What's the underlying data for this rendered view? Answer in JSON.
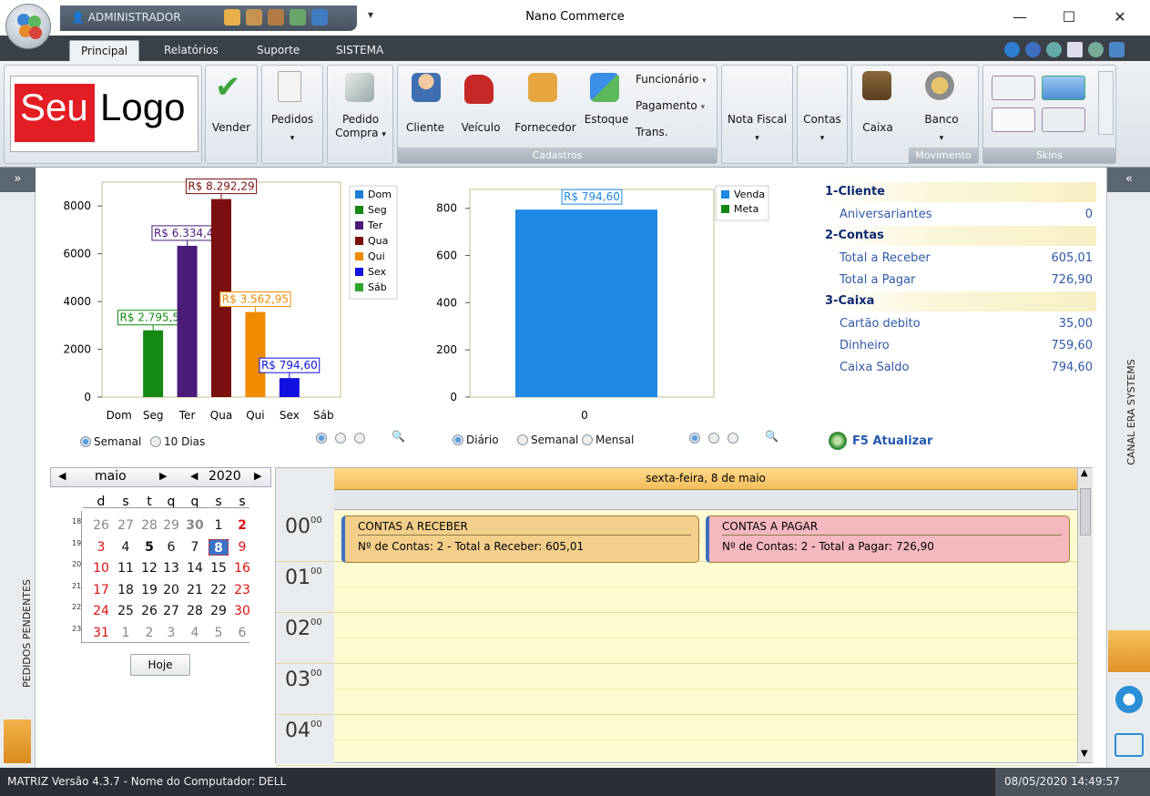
{
  "window": {
    "title": "Nano Commerce",
    "user": "ADMINISTRADOR",
    "controls": {
      "minimize": "—",
      "maximize": "☐",
      "close": "✕"
    },
    "qat_dropdown": "▾"
  },
  "tabs": [
    "Principal",
    "Relatórios",
    "Suporte",
    "SISTEMA"
  ],
  "logo": {
    "part1": "Seu",
    "part2": "Logo"
  },
  "ribbon": {
    "vender": "Vender",
    "pedidos": "Pedidos",
    "pedido_compra_1": "Pedido",
    "pedido_compra_2": "Compra",
    "cliente": "Cliente",
    "veiculo": "Veículo",
    "fornecedor": "Fornecedor",
    "estoque": "Estoque",
    "funcionario": "Funcionário",
    "pagamento": "Pagamento",
    "trans": "Trans.",
    "cadastros_caption": "Cadastros",
    "nota_fiscal": "Nota Fiscal",
    "contas": "Contas",
    "caixa": "Caixa",
    "banco": "Banco",
    "movimento_caption": "Movimento",
    "skins_caption": "Skins",
    "arrow": "▾"
  },
  "left_panel": {
    "toggle": "»",
    "label": "PEDIDOS PENDENTES"
  },
  "right_panel": {
    "toggle": "«",
    "label": "CANAL ERA SYSTEMS"
  },
  "chart_data": [
    {
      "type": "bar",
      "categories": [
        "Dom",
        "Seg",
        "Ter",
        "Qua",
        "Qui",
        "Sex",
        "Sáb"
      ],
      "values": [
        0,
        2795.58,
        6334.44,
        8292.29,
        3562.95,
        794.6,
        0
      ],
      "data_labels": [
        "",
        "R$ 2.795,58",
        "R$ 6.334,44",
        "R$ 8.292,29",
        "R$ 3.562,95",
        "R$ 794,60",
        ""
      ],
      "colors": [
        "#1e7fd6",
        "#148a14",
        "#4b1b7a",
        "#7a0f0f",
        "#f08a00",
        "#1010e0",
        "#2ea52e"
      ],
      "ylim": [
        0,
        9000
      ],
      "yticks": [
        "0",
        "2000",
        "4000",
        "6000",
        "8000"
      ],
      "legend": [
        "Dom",
        "Seg",
        "Ter",
        "Qua",
        "Qui",
        "Sex",
        "Sáb"
      ],
      "legend_position": "right"
    },
    {
      "type": "bar",
      "categories": [
        "0"
      ],
      "series": [
        {
          "name": "Venda",
          "values": [
            794.6
          ],
          "color": "#1e88e5"
        },
        {
          "name": "Meta",
          "values": [
            0
          ],
          "color": "#148a14"
        }
      ],
      "data_labels": [
        "R$ 794,60"
      ],
      "ylim": [
        0,
        880
      ],
      "yticks": [
        "0",
        "200",
        "400",
        "600",
        "800"
      ],
      "legend_position": "right"
    }
  ],
  "chart_controls": {
    "semanal": "Semanal",
    "dez_dias": "10 Dias",
    "diario": "Diário",
    "semanal2": "Semanal",
    "mensal": "Mensal",
    "refresh": "F5 Atualizar"
  },
  "summary": [
    {
      "heading": "1-Cliente",
      "rows": [
        {
          "label": "Aniversariantes",
          "value": "0"
        }
      ]
    },
    {
      "heading": "2-Contas",
      "rows": [
        {
          "label": "Total a Receber",
          "value": "605,01"
        },
        {
          "label": "Total a Pagar",
          "value": "726,90"
        }
      ]
    },
    {
      "heading": "3-Caixa",
      "rows": [
        {
          "label": "Cartão debito",
          "value": "35,00"
        },
        {
          "label": "Dinheiro",
          "value": "759,60"
        },
        {
          "label": "Caixa Saldo",
          "value": "794,60"
        }
      ]
    }
  ],
  "calendar": {
    "month": "maio",
    "year": "2020",
    "today_button": "Hoje",
    "weekdays": [
      "d",
      "s",
      "t",
      "q",
      "q",
      "s",
      "s"
    ],
    "weeks": [
      {
        "num": "18",
        "days": [
          "26",
          "27",
          "28",
          "29",
          "30",
          "1",
          "2"
        ]
      },
      {
        "num": "19",
        "days": [
          "3",
          "4",
          "5",
          "6",
          "7",
          "8",
          "9"
        ]
      },
      {
        "num": "20",
        "days": [
          "10",
          "11",
          "12",
          "13",
          "14",
          "15",
          "16"
        ]
      },
      {
        "num": "21",
        "days": [
          "17",
          "18",
          "19",
          "20",
          "21",
          "22",
          "23"
        ]
      },
      {
        "num": "22",
        "days": [
          "24",
          "25",
          "26",
          "27",
          "28",
          "29",
          "30"
        ]
      },
      {
        "num": "23",
        "days": [
          "31",
          "1",
          "2",
          "3",
          "4",
          "5",
          "6"
        ]
      }
    ],
    "selected": "8"
  },
  "scheduler": {
    "date_header": "sexta-feira, 8 de maio",
    "hours": [
      {
        "h": "00",
        "m": "00"
      },
      {
        "h": "01",
        "m": "00"
      },
      {
        "h": "02",
        "m": "00"
      },
      {
        "h": "03",
        "m": "00"
      },
      {
        "h": "04",
        "m": "00"
      }
    ],
    "appointments": [
      {
        "title": "CONTAS A RECEBER",
        "detail": "Nº de Contas: 2 - Total a Receber: 605,01",
        "color": "#f2cf8a"
      },
      {
        "title": "CONTAS A PAGAR",
        "detail": "Nº de Contas: 2 - Total a Pagar: 726,90",
        "color": "#f5b8bf"
      }
    ]
  },
  "status": {
    "left": "MATRIZ  Versão 4.3.7  - Nome do Computador: DELL",
    "datetime": "08/05/2020 14:49:57"
  }
}
